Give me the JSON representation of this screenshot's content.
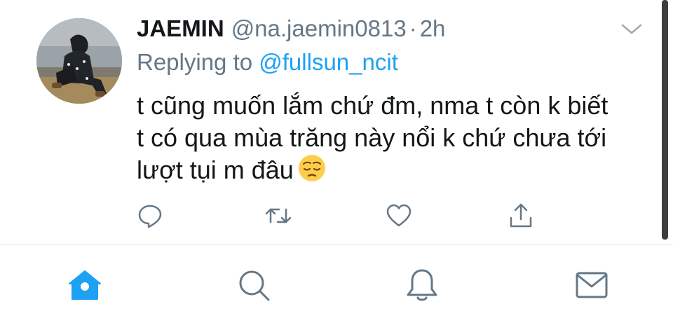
{
  "tweet": {
    "display_name": "JAEMIN",
    "handle": "@na.jaemin0813",
    "separator": "·",
    "time": "2h",
    "replying_prefix": "Replying to ",
    "replying_to": "@fullsun_ncit",
    "body_lines": [
      "t cũng muốn lắm chứ đm, nma t còn k biết",
      "t có qua mùa trăng này nổi k chứ chưa tới",
      "lượt tụi m đâu"
    ],
    "emoji": "pensive-face"
  },
  "icons": {
    "reply": "reply-icon",
    "retweet": "retweet-icon",
    "like": "heart-icon",
    "share": "share-icon",
    "more": "chevron-down-icon"
  },
  "tabbar": {
    "items": [
      "home-icon",
      "search-icon",
      "notifications-icon",
      "messages-icon"
    ],
    "active": "home-icon"
  },
  "colors": {
    "accent": "#1da1f2",
    "text": "#14171a",
    "secondary": "#657786",
    "icon_gray": "#657786",
    "divider": "#e1e8ed"
  }
}
